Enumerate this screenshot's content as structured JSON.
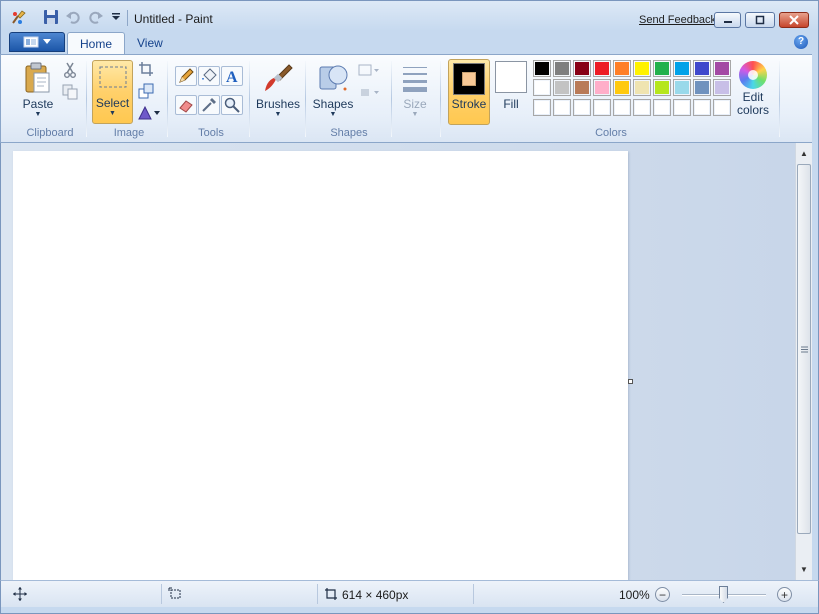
{
  "window": {
    "title": "Untitled - Paint",
    "send_feedback": "Send Feedback"
  },
  "tabs": [
    {
      "label": "Home",
      "active": true
    },
    {
      "label": "View",
      "active": false
    }
  ],
  "ribbon": {
    "clipboard": {
      "paste_label": "Paste",
      "group_label": "Clipboard"
    },
    "image": {
      "select_label": "Select",
      "group_label": "Image"
    },
    "tools": {
      "group_label": "Tools"
    },
    "brushes": {
      "label": "Brushes"
    },
    "shapes": {
      "label": "Shapes",
      "group_label": "Shapes"
    },
    "size": {
      "label": "Size"
    },
    "colors": {
      "stroke_label": "Stroke",
      "fill_label": "Fill",
      "edit_colors_label": "Edit colors",
      "group_label": "Colors",
      "stroke_color": "#f9c996",
      "fill_color": "#ffffff",
      "palette_row1": [
        "#000000",
        "#7f7f7f",
        "#880015",
        "#ed1c24",
        "#ff7f27",
        "#fff200",
        "#22b14c",
        "#00a2e8",
        "#3f48cc",
        "#a349a4"
      ],
      "palette_row2": [
        "#ffffff",
        "#c3c3c3",
        "#b97a57",
        "#ffaec9",
        "#ffc90e",
        "#efe4b0",
        "#b5e61d",
        "#99d9ea",
        "#7092be",
        "#c8bfe7"
      ],
      "palette_row3": [
        "#ffffff",
        "#ffffff",
        "#ffffff",
        "#ffffff",
        "#ffffff",
        "#ffffff",
        "#ffffff",
        "#ffffff",
        "#ffffff",
        "#ffffff"
      ]
    }
  },
  "statusbar": {
    "image_size": "614 × 460px",
    "zoom": "100%",
    "zoom_level": 1.0
  }
}
